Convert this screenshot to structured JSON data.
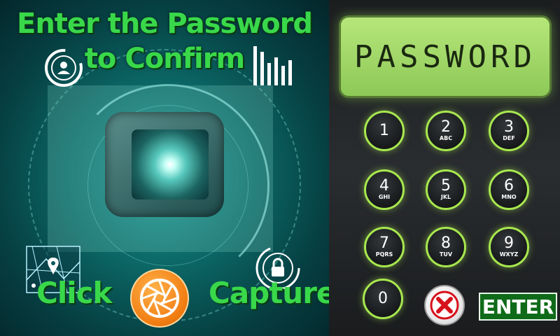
{
  "title": {
    "line1": "Enter the Password",
    "line2": "to Confirm"
  },
  "camera": {
    "click_label": "Click",
    "capture_label": "Capture",
    "capture_icon": "aperture-icon"
  },
  "icons": {
    "user": "user-circle-icon",
    "signal": "signal-bars-icon",
    "map": "map-pin-icon",
    "lock": "lock-icon"
  },
  "keypad": {
    "display_text": "PASSWORD",
    "keys": [
      {
        "num": "1",
        "letters": ""
      },
      {
        "num": "2",
        "letters": "ABC"
      },
      {
        "num": "3",
        "letters": "DEF"
      },
      {
        "num": "4",
        "letters": "GHI"
      },
      {
        "num": "5",
        "letters": "JKL"
      },
      {
        "num": "6",
        "letters": "MNO"
      },
      {
        "num": "7",
        "letters": "PQRS"
      },
      {
        "num": "8",
        "letters": "TUV"
      },
      {
        "num": "9",
        "letters": "WXYZ"
      },
      {
        "num": "0",
        "letters": ""
      }
    ],
    "enter_label": "ENTER",
    "clear_icon": "clear-x-icon"
  },
  "colors": {
    "accent_green": "#39d84a",
    "key_ring": "#a8e84f",
    "lcd": "#a4d96a",
    "capture_orange": "#f07b10",
    "clear_red": "#d6121b",
    "enter_bg": "#0f6b1a"
  }
}
